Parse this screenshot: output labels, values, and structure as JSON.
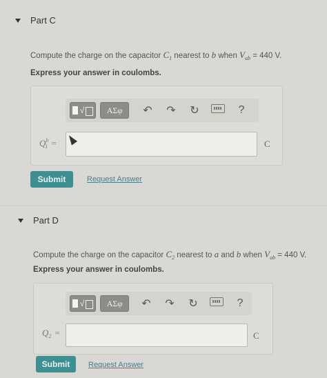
{
  "part_c": {
    "title": "Part C",
    "prompt_pre": "Compute the charge on the capacitor ",
    "cap": "C",
    "cap_sub": "1",
    "prompt_mid": " nearest to ",
    "point": "b",
    "prompt_when": " when ",
    "v": "V",
    "v_sub": "ab",
    "prompt_end": " = 440 V.",
    "instruction": "Express your answer in coulombs.",
    "label_var": "Q",
    "label_sup": "b",
    "label_sub": "1",
    "equals": "=",
    "unit": "C",
    "input_value": "",
    "submit": "Submit",
    "request": "Request Answer"
  },
  "part_d": {
    "title": "Part D",
    "prompt_pre": "Compute the charge on the capacitor ",
    "cap": "C",
    "cap_sub": "2",
    "prompt_mid": " nearest to ",
    "point_a": "a",
    "and": " and ",
    "point_b": "b",
    "prompt_when": " when ",
    "v": "V",
    "v_sub": "ab",
    "prompt_end": " = 440 V.",
    "instruction": "Express your answer in coulombs.",
    "label_var": "Q",
    "label_sub": "2",
    "equals": "=",
    "unit": "C",
    "input_value": "",
    "submit": "Submit",
    "request": "Request Answer"
  },
  "toolbar": {
    "templates_symbol": "√□",
    "greek": "ΑΣφ",
    "undo": "↶",
    "redo": "↷",
    "reset": "↻",
    "help": "?"
  }
}
